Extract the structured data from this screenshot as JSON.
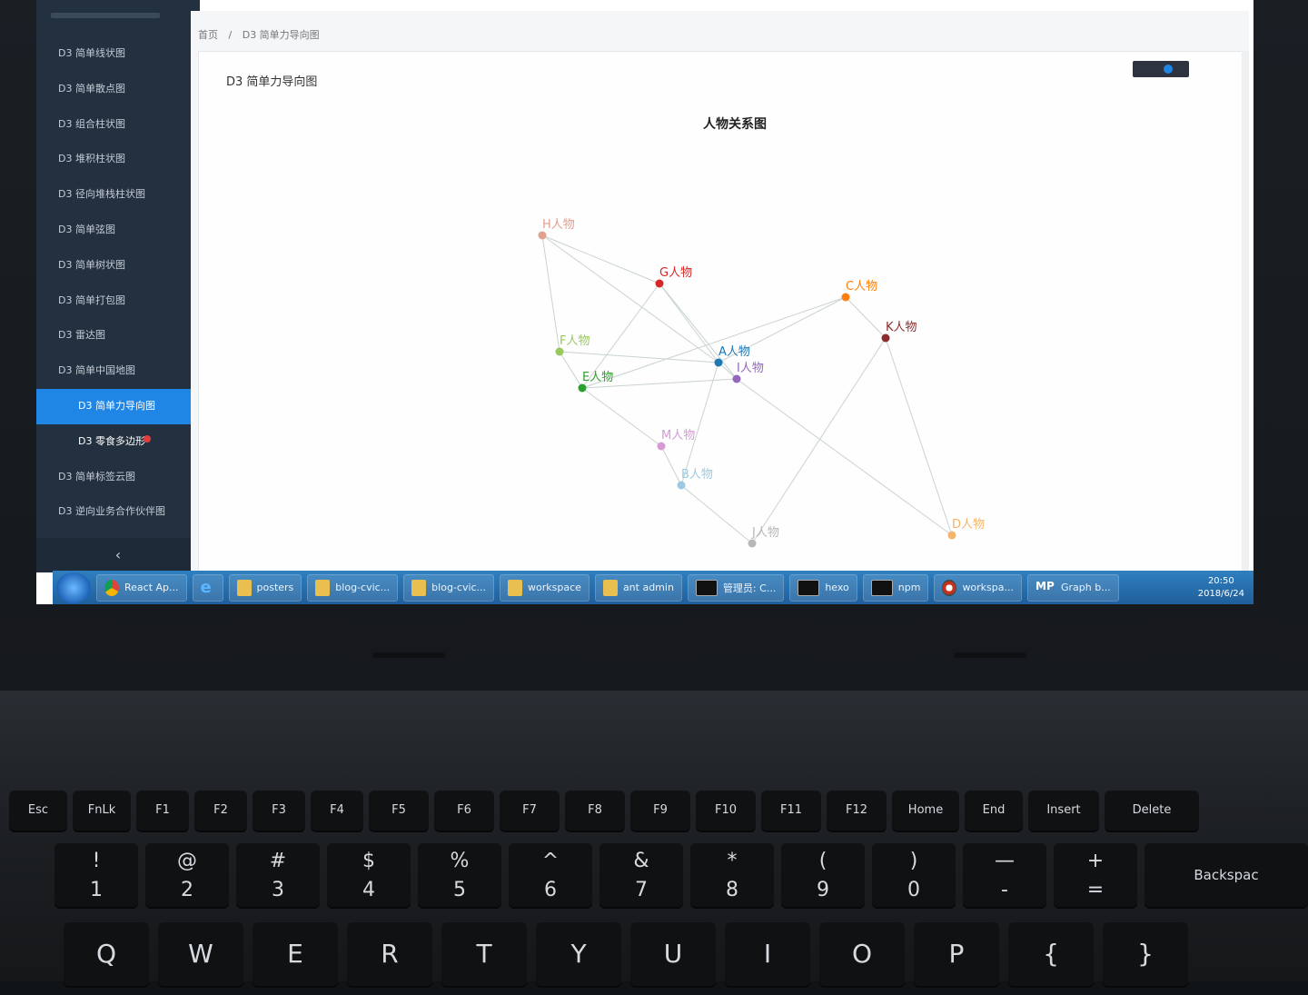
{
  "sidebar": {
    "items": [
      {
        "label": "D3 简单线状图"
      },
      {
        "label": "D3 简单散点图"
      },
      {
        "label": "D3 组合柱状图"
      },
      {
        "label": "D3 堆积柱状图"
      },
      {
        "label": "D3 径向堆栈柱状图"
      },
      {
        "label": "D3 简单弦图"
      },
      {
        "label": "D3 简单树状图"
      },
      {
        "label": "D3 简单打包图"
      },
      {
        "label": "D3 雷达图"
      },
      {
        "label": "D3 简单中国地图"
      },
      {
        "label": "D3 简单力导向图",
        "active": true
      },
      {
        "label": "D3 零食多边形"
      },
      {
        "label": "D3 简单标签云图"
      },
      {
        "label": "D3 逆向业务合作伙伴图"
      }
    ],
    "collapse_label": "‹"
  },
  "breadcrumb": {
    "home": "首页",
    "separator": "/",
    "current": "D3 简单力导向图"
  },
  "panel": {
    "title": "D3 简单力导向图"
  },
  "chart_data": {
    "type": "force-graph",
    "title": "人物关系图",
    "nodes": [
      {
        "id": "H人物",
        "color": "#e2a08f"
      },
      {
        "id": "G人物",
        "color": "#d62728"
      },
      {
        "id": "C人物",
        "color": "#ff7f0e"
      },
      {
        "id": "K人物",
        "color": "#8c2d2d"
      },
      {
        "id": "F人物",
        "color": "#98c95f"
      },
      {
        "id": "A人物",
        "color": "#1f77b4"
      },
      {
        "id": "I人物",
        "color": "#9467bd"
      },
      {
        "id": "E人物",
        "color": "#2ca02c"
      },
      {
        "id": "M人物",
        "color": "#d79ad6"
      },
      {
        "id": "B人物",
        "color": "#9ecae1"
      },
      {
        "id": "J人物",
        "color": "#b7b7b7"
      },
      {
        "id": "D人物",
        "color": "#f3b56b"
      }
    ]
  },
  "taskbar": {
    "items": [
      {
        "label": "React Ap...",
        "icon": "chrome-icon"
      },
      {
        "label": "",
        "icon": "ie-icon"
      },
      {
        "label": "posters",
        "icon": "folder-icon"
      },
      {
        "label": "blog-cvic...",
        "icon": "folder-icon"
      },
      {
        "label": "blog-cvic...",
        "icon": "folder-icon"
      },
      {
        "label": "workspace",
        "icon": "folder-icon"
      },
      {
        "label": "ant admin",
        "icon": "folder-icon"
      },
      {
        "label": "管理员: C...",
        "icon": "cmd-icon"
      },
      {
        "label": "hexo",
        "icon": "cmd-icon"
      },
      {
        "label": "npm",
        "icon": "cmd-icon"
      },
      {
        "label": "workspa...",
        "icon": "gear-icon"
      },
      {
        "label": "Graph b...",
        "icon": "mp-icon"
      }
    ],
    "time": "20:50",
    "date": "2018/6/24"
  },
  "keyboard": {
    "fn_keys": [
      "Esc",
      "FnLk",
      "F1",
      "F2",
      "F3",
      "F4",
      "F5",
      "F6",
      "F7",
      "F8",
      "F9",
      "F10",
      "F11",
      "F12",
      "Home",
      "End",
      "Insert",
      "Delete"
    ],
    "num_keys": [
      [
        "!",
        "1"
      ],
      [
        "@",
        "2"
      ],
      [
        "#",
        "3"
      ],
      [
        "$",
        "4"
      ],
      [
        "%",
        "5"
      ],
      [
        "^",
        "6"
      ],
      [
        "&",
        "7"
      ],
      [
        "*",
        "8"
      ],
      [
        "(",
        "9"
      ],
      [
        ")",
        "0"
      ],
      [
        "—",
        "-"
      ],
      [
        "+",
        "="
      ]
    ],
    "backspace": "Backspac",
    "letter_keys": [
      "Q",
      "W",
      "E",
      "R",
      "T",
      "Y",
      "U",
      "I",
      "O",
      "P",
      "{",
      "}"
    ]
  }
}
